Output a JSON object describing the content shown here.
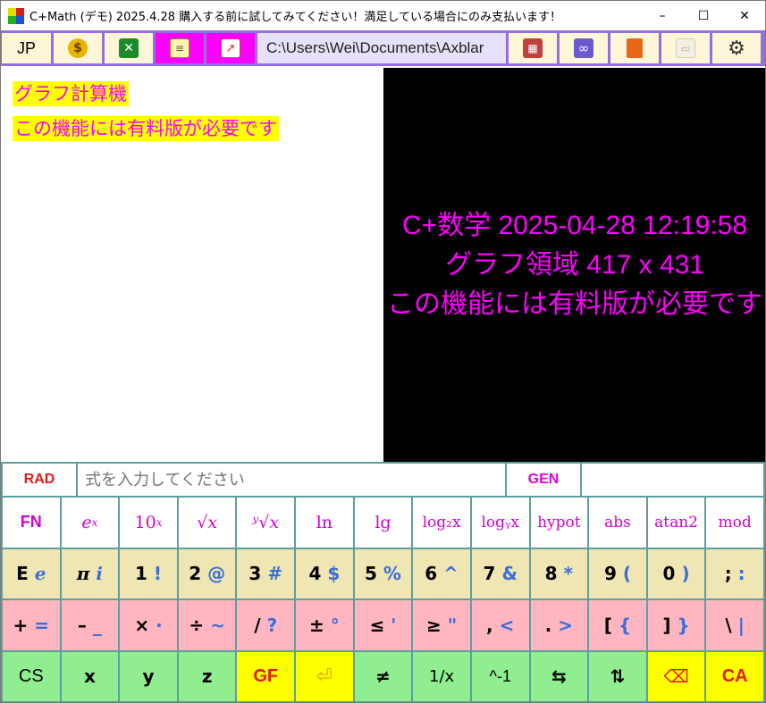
{
  "window": {
    "title": "C+Math (デモ) 2025.4.28 購入する前に試してみてください！満足している場合にのみ支払います！",
    "controls": {
      "minimize": "–",
      "maximize": "☐",
      "close": "✕"
    }
  },
  "toolbar": {
    "language": "JP",
    "path": "C:\\Users\\Wei\\Documents\\Axblar",
    "icons": [
      "money-bag-icon",
      "excel-icon",
      "notepad-icon",
      "chart-icon",
      "calculator-icon",
      "infinity-icon",
      "book-icon",
      "image-icon",
      "gear-icon"
    ]
  },
  "left_pane": {
    "line1": "グラフ計算機",
    "line2": "この機能には有料版が必要です"
  },
  "graph_pane": {
    "line1": "C+数学 2025-04-28 12:19:58",
    "line2": "グラフ領域 417 x 431",
    "line3": "この機能には有料版が必要です"
  },
  "input_row": {
    "mode": "RAD",
    "placeholder": "式を入力してください",
    "gen": "GEN"
  },
  "keypad": {
    "row1": [
      "FN",
      "e",
      "10",
      "√x",
      "ʸ√x",
      "ln",
      "lg",
      "log₂x",
      "logᵧx",
      "hypot",
      "abs",
      "atan2",
      "mod"
    ],
    "row2": [
      {
        "a": "E",
        "b": "e"
      },
      {
        "a": "π",
        "b": "i"
      },
      {
        "a": "1",
        "b": "!"
      },
      {
        "a": "2",
        "b": "@"
      },
      {
        "a": "3",
        "b": "#"
      },
      {
        "a": "4",
        "b": "$"
      },
      {
        "a": "5",
        "b": "%"
      },
      {
        "a": "6",
        "b": "^"
      },
      {
        "a": "7",
        "b": "&"
      },
      {
        "a": "8",
        "b": "*"
      },
      {
        "a": "9",
        "b": "("
      },
      {
        "a": "0",
        "b": ")"
      },
      {
        "a": ";",
        "b": ":"
      }
    ],
    "row3": [
      {
        "a": "+",
        "b": "="
      },
      {
        "a": "–",
        "b": "_"
      },
      {
        "a": "×",
        "b": "·"
      },
      {
        "a": "÷",
        "b": "~"
      },
      {
        "a": "/",
        "b": "?"
      },
      {
        "a": "±",
        "b": "°"
      },
      {
        "a": "≤",
        "b": "'"
      },
      {
        "a": "≥",
        "b": "\""
      },
      {
        "a": ",",
        "b": "<"
      },
      {
        "a": ".",
        "b": ">"
      },
      {
        "a": "[",
        "b": "{"
      },
      {
        "a": "]",
        "b": "}"
      },
      {
        "a": "\\",
        "b": "|"
      }
    ],
    "row4": [
      "CS",
      "x",
      "y",
      "z",
      "GF",
      "⏎",
      "≠",
      "1/x",
      "^-1",
      "⇆",
      "⇅",
      "⌫",
      "CA"
    ],
    "sup_e": "x",
    "sup_10": "x"
  },
  "colors": {
    "toolbar_border": "#9370db",
    "magenta": "#ff00ff",
    "teal": "#5f9e9e",
    "tan": "#f0e6b4",
    "pink": "#ffb6c1",
    "green": "#90ee90",
    "yellow": "#ffff00"
  }
}
